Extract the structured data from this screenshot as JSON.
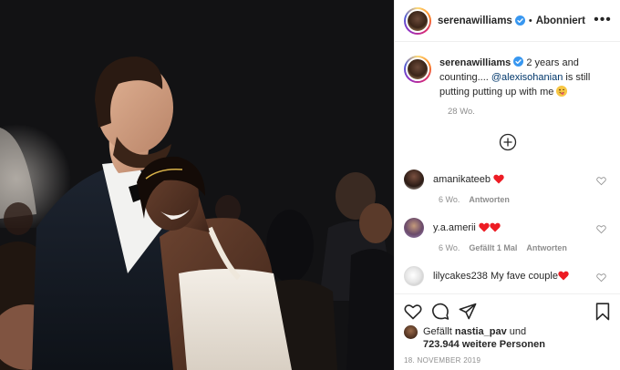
{
  "header": {
    "username": "serenawilliams",
    "separator": "•",
    "follow_state": "Abonniert",
    "more_glyph": "•••"
  },
  "caption": {
    "username": "serenawilliams",
    "text_before": " 2 years and counting.... ",
    "mention": "@alexisohanian",
    "text_after": " is still putting putting up with me ",
    "time": "28 Wo."
  },
  "comments": [
    {
      "username": "amanikateeb",
      "text": "",
      "time": "6 Wo.",
      "likes": "",
      "reply": "Antworten",
      "hearts": 1
    },
    {
      "username": "y.a.amerii",
      "text": "",
      "time": "6 Wo.",
      "likes": "Gefällt 1 Mal",
      "reply": "Antworten",
      "hearts": 2
    },
    {
      "username": "lilycakes238",
      "text": "My fave couple",
      "time": "",
      "likes": "",
      "reply": "",
      "hearts": 1
    }
  ],
  "likes": {
    "prefix": "Gefällt ",
    "liker": "nastia_pav",
    "middle": " und",
    "count": "723.944 weitere Personen"
  },
  "date": "18. NOVEMBER 2019",
  "icons": {
    "verified": "verified-badge-icon",
    "more": "more-options-icon",
    "load_more": "plus-circle-icon",
    "like": "heart-icon",
    "comment": "comment-icon",
    "share": "share-icon",
    "save": "bookmark-icon"
  },
  "colors": {
    "verified_blue": "#3897f0",
    "heart_red": "#ed1c24",
    "mention": "#00376b",
    "muted": "#8e8e8e"
  }
}
